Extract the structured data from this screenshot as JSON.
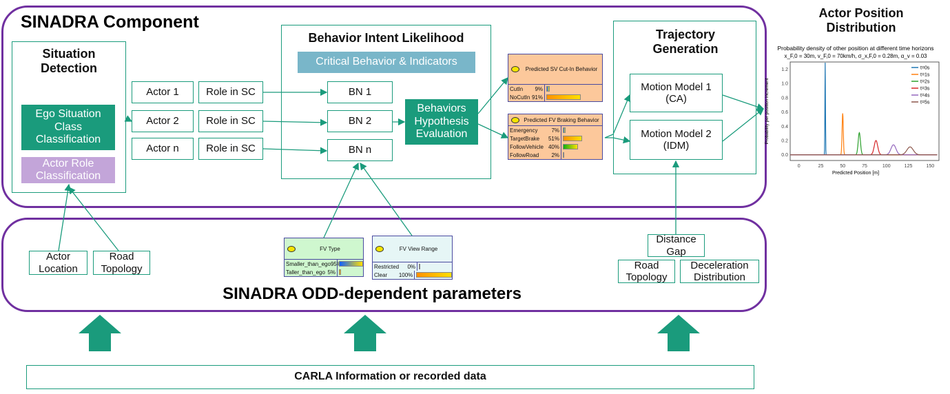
{
  "sinadra": {
    "title": "SINADRA Component",
    "odd_title": "SINADRA ODD-dependent parameters"
  },
  "situation": {
    "title": "Situation Detection",
    "ego": "Ego Situation Class Classification",
    "role": "Actor Role Classification"
  },
  "actors": [
    {
      "actor": "Actor 1",
      "role": "Role in SC",
      "bn": "BN 1"
    },
    {
      "actor": "Actor 2",
      "role": "Role in SC",
      "bn": "BN 2"
    },
    {
      "actor": "Actor n",
      "role": "Role in SC",
      "bn": "BN n"
    }
  ],
  "bil": {
    "title": "Behavior Intent Likelihood",
    "critical": "Critical Behavior & Indicators",
    "hyp": "Behaviors Hypothesis Evaluation"
  },
  "node_cutin": {
    "title": "Predicted SV Cut-In Behavior",
    "states": [
      {
        "label": "CutIn",
        "pct": "9%",
        "value": 9,
        "color": "#1060ff"
      },
      {
        "label": "NoCutIn",
        "pct": "91%",
        "value": 91,
        "color": "#ff9000"
      }
    ]
  },
  "node_brake": {
    "title": "Predicted FV Braking Behavior",
    "states": [
      {
        "label": "Emergency",
        "pct": "7%",
        "value": 7,
        "color": "#1060ff"
      },
      {
        "label": "TargetBrake",
        "pct": "51%",
        "value": 51,
        "color": "#ff9000"
      },
      {
        "label": "FollowVehicle",
        "pct": "40%",
        "value": 40,
        "color": "#10b010"
      },
      {
        "label": "FollowRoad",
        "pct": "2%",
        "value": 2,
        "color": "#a020c0"
      }
    ]
  },
  "node_fvtype": {
    "title": "FV Type",
    "states": [
      {
        "label": "Smaller_than_ego",
        "pct": "95%",
        "value": 95,
        "color": "#1060ff"
      },
      {
        "label": "Taller_than_ego",
        "pct": "5%",
        "value": 5,
        "color": "#ff9000"
      }
    ]
  },
  "node_fvview": {
    "title": "FV View Range",
    "states": [
      {
        "label": "Restricted",
        "pct": "0%",
        "value": 0,
        "color": "#1060ff"
      },
      {
        "label": "Clear",
        "pct": "100%",
        "value": 100,
        "color": "#ff9000"
      }
    ]
  },
  "traj": {
    "title": "Trajectory Generation",
    "mm1": "Motion Model 1 (CA)",
    "mm2": "Motion Model 2 (IDM)"
  },
  "odd": {
    "actor_location": "Actor Location",
    "road_topology_left": "Road Topology",
    "distance_gap": "Distance Gap",
    "road_topology_right": "Road Topology",
    "decel": "Deceleration Distribution"
  },
  "carla": "CARLA Information or recorded data",
  "apd_title": "Actor Position Distribution",
  "colors": {
    "purple": "#7030a0",
    "teal": "#1a9b7c",
    "lavender": "#c3a5d9",
    "light_blue": "#79b6c9",
    "node_orange": "#fcc89b"
  },
  "chart_data": {
    "type": "line",
    "title": "Probability density of other position at different time horizons",
    "subtitle": "x_F,0 = 30m, v_F,0 = 70km/h, σ_x,F,0 = 0.28m, α_v = 0.03",
    "xlabel": "Predicted Position [m]",
    "ylabel": "Probability per position increment",
    "xlim": [
      -10,
      160
    ],
    "ylim": [
      0,
      1.3
    ],
    "xticks": [
      0,
      25,
      50,
      75,
      100,
      125,
      150
    ],
    "yticks": [
      0.0,
      0.2,
      0.4,
      0.6,
      0.8,
      1.0,
      1.2
    ],
    "legend": "top-right",
    "series": [
      {
        "name": "t=0s",
        "mean": 30,
        "peak": 1.29,
        "color": "#1f77b4"
      },
      {
        "name": "t=1s",
        "mean": 50,
        "peak": 0.58,
        "color": "#ff7f0e"
      },
      {
        "name": "t=2s",
        "mean": 69,
        "peak": 0.31,
        "color": "#2ca02c"
      },
      {
        "name": "t=3s",
        "mean": 88,
        "peak": 0.2,
        "color": "#d62728"
      },
      {
        "name": "t=4s",
        "mean": 108,
        "peak": 0.14,
        "color": "#9467bd"
      },
      {
        "name": "t=5s",
        "mean": 127,
        "peak": 0.11,
        "color": "#8c564b"
      }
    ]
  }
}
